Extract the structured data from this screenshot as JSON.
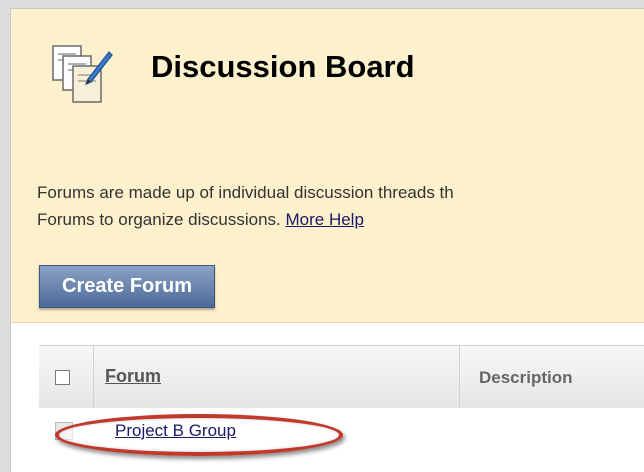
{
  "header": {
    "title": "Discussion Board",
    "description_line1": "Forums are made up of individual discussion threads th",
    "description_line2": "Forums to organize discussions. ",
    "more_help_link": "More Help",
    "icon": "discussion-board-icon"
  },
  "toolbar": {
    "create_forum_label": "Create Forum"
  },
  "table": {
    "columns": [
      "Forum",
      "Description"
    ],
    "rows": [
      {
        "forum": "Project B Group",
        "description": ""
      }
    ]
  },
  "colors": {
    "header_bg": "#fdf0cc",
    "button_bg": "#5b77a3",
    "link": "#1a1a66",
    "highlight_ring": "#c0392b"
  }
}
